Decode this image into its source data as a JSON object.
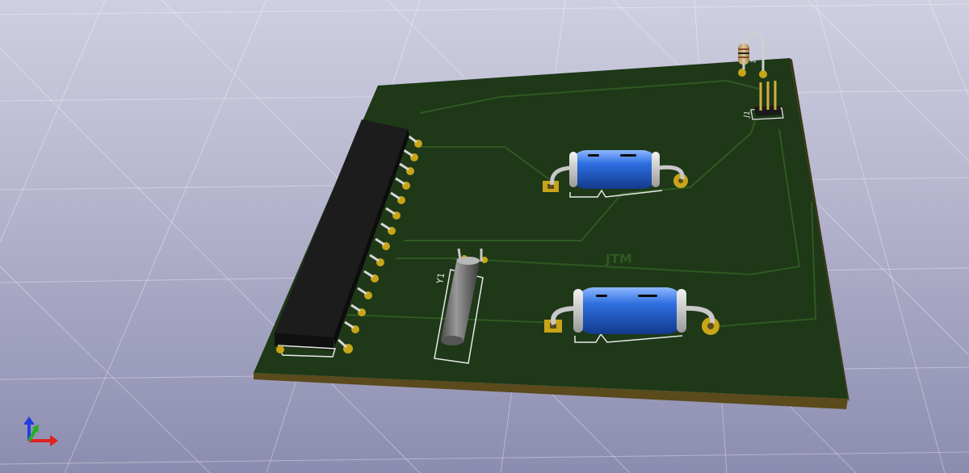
{
  "viewer": {
    "background_top": "#cfcfe1",
    "background_bottom": "#8c8cb0"
  },
  "board": {
    "solder_mask_color": "#1e3818",
    "board_edge_color": "#5a4a1c",
    "silkscreen_color": "#e8e8e8",
    "copper_color": "#c8a418",
    "text": "JTM"
  },
  "components": {
    "crystal": {
      "reference": "Y1"
    },
    "header": {
      "reference": "J1"
    },
    "resistor": {
      "reference": "1"
    }
  },
  "axis_gizmo": {
    "icon": "xyz-axes-icon",
    "x_color": "#e02020",
    "y_color": "#20b020",
    "z_color": "#2040e0"
  }
}
